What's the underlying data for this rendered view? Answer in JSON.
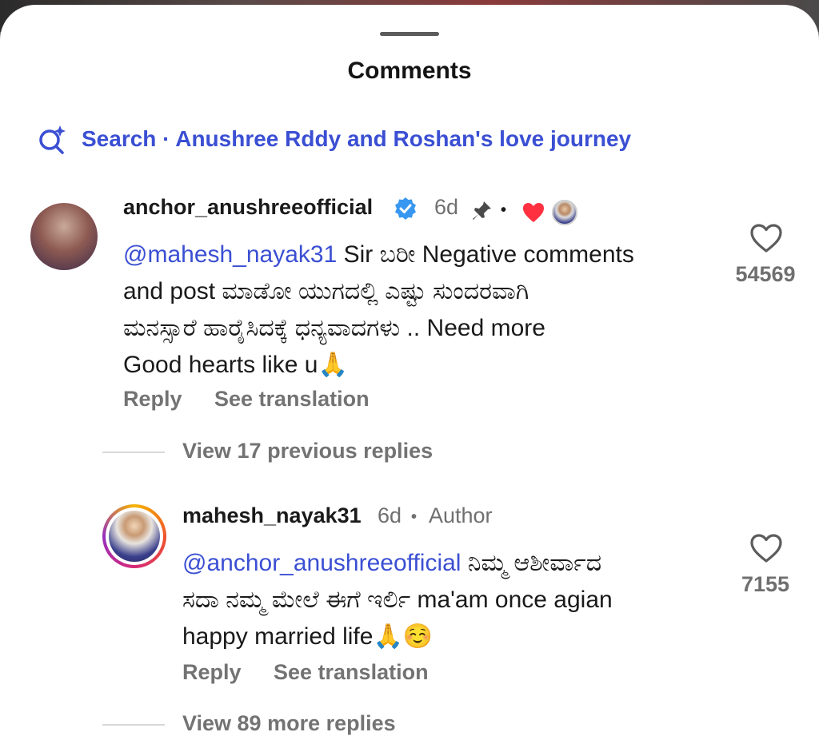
{
  "sheet": {
    "title": "Comments"
  },
  "search": {
    "label": "Search · Anushree Rddy and Roshan's love journey"
  },
  "comment1": {
    "username": "anchor_anushreeofficial",
    "time": "6d",
    "dot": "•",
    "mention": "@mahesh_nayak31",
    "lines": [
      " Sir ಬರೀ Negative comments",
      "and post ಮಾಡೋ ಯುಗದಲ್ಲಿ ಎಷ್ಟು ಸುಂದರವಾಗಿ",
      "ಮನಸ್ಸಾರೆ ಹಾರೈಸಿದಕ್ಕೆ ಧನ್ಯವಾದಗಳು .. Need more",
      "Good hearts like u🙏"
    ],
    "like_count": "54569",
    "reply_label": "Reply",
    "translate_label": "See translation"
  },
  "view_previous": "View 17 previous replies",
  "reply1": {
    "username": "mahesh_nayak31",
    "time": "6d",
    "dot": "•",
    "author_label": "Author",
    "mention": "@anchor_anushreeofficial",
    "lines": [
      " ನಿಮ್ಮ ಆಶೀರ್ವಾದ",
      "ಸದಾ ನಮ್ಮ ಮೇಲೆ ಈಗೆ ಇರ್ಲಿ ma'am once agian",
      "happy married life🙏☺️"
    ],
    "like_count": "7155",
    "reply_label": "Reply",
    "translate_label": "See translation"
  },
  "view_more": "View 89 more replies",
  "icons": {
    "search": "sparkle-search-icon",
    "verified": "verified-badge-icon",
    "pin": "pin-icon",
    "heart_reaction": "red-heart-icon",
    "like": "heart-outline-icon"
  },
  "colors": {
    "accent": "#3b4fd3",
    "verified": "#3897f0",
    "heart": "#ff3040"
  }
}
